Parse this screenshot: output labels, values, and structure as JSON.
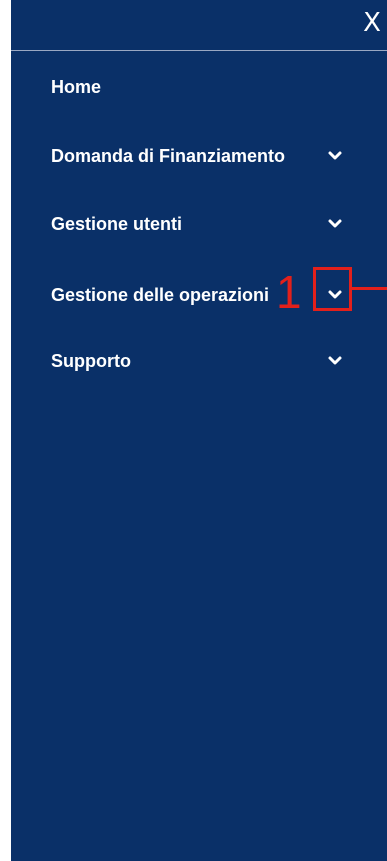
{
  "menu": {
    "close_label": "X",
    "items": [
      {
        "label": "Home",
        "has_submenu": false
      },
      {
        "label": "Domanda di Finanziamento",
        "has_submenu": true
      },
      {
        "label": "Gestione utenti",
        "has_submenu": true
      },
      {
        "label": "Gestione delle operazioni",
        "has_submenu": true
      },
      {
        "label": "Supporto",
        "has_submenu": true
      }
    ]
  },
  "annotation": {
    "number": "1",
    "color": "#e3201b"
  },
  "colors": {
    "panel_background": "#0a3068",
    "text": "#ffffff"
  }
}
